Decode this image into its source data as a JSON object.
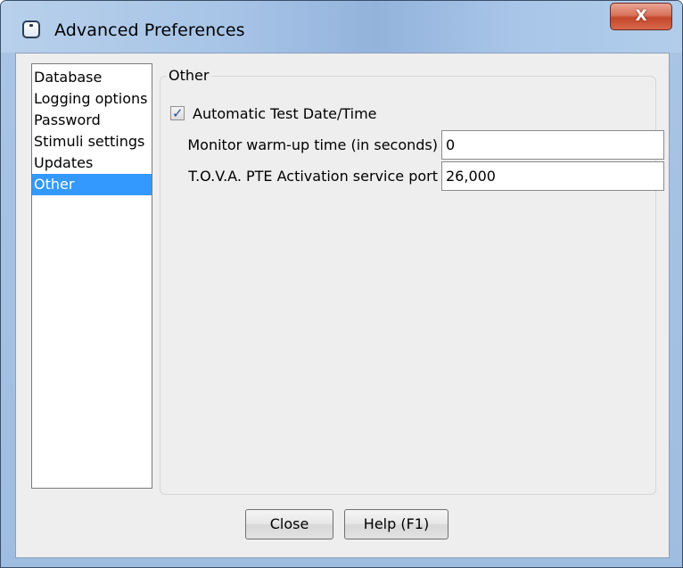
{
  "window": {
    "title": "Advanced Preferences",
    "close_glyph": "X"
  },
  "sidebar": {
    "items": [
      {
        "label": "Database",
        "selected": false
      },
      {
        "label": "Logging options",
        "selected": false
      },
      {
        "label": "Password",
        "selected": false
      },
      {
        "label": "Stimuli settings",
        "selected": false
      },
      {
        "label": "Updates",
        "selected": false
      },
      {
        "label": "Other",
        "selected": true
      }
    ]
  },
  "panel": {
    "title": "Other",
    "automatic_test": {
      "label": "Automatic Test Date/Time",
      "checked": true,
      "check_glyph": "✓"
    },
    "warmup": {
      "label": "Monitor warm-up time (in seconds)",
      "value": "0"
    },
    "port": {
      "label": "T.O.V.A. PTE Activation service port",
      "value": "26,000"
    }
  },
  "footer": {
    "close_label": "Close",
    "help_label": "Help (F1)"
  },
  "colors": {
    "selection": "#3399ff",
    "titlebar": "#a6c3e6",
    "close_button": "#c4462b",
    "dialog_background": "#eeeeee"
  },
  "icons": [
    "app-window-icon",
    "window-close-icon",
    "checkmark-icon"
  ]
}
